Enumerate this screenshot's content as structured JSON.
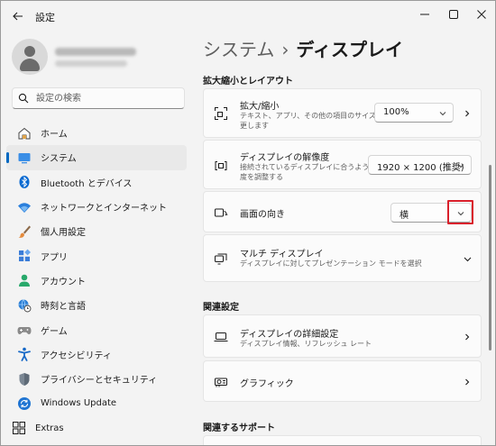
{
  "window": {
    "title": "設定"
  },
  "search": {
    "placeholder": "設定の検索"
  },
  "nav": [
    {
      "label": "ホーム",
      "icon": "home-icon"
    },
    {
      "label": "システム",
      "icon": "system-icon",
      "active": true
    },
    {
      "label": "Bluetooth とデバイス",
      "icon": "bluetooth-icon"
    },
    {
      "label": "ネットワークとインターネット",
      "icon": "wifi-icon"
    },
    {
      "label": "個人用設定",
      "icon": "brush-icon"
    },
    {
      "label": "アプリ",
      "icon": "apps-icon"
    },
    {
      "label": "アカウント",
      "icon": "account-icon"
    },
    {
      "label": "時刻と言語",
      "icon": "globe-clock-icon"
    },
    {
      "label": "ゲーム",
      "icon": "gamepad-icon"
    },
    {
      "label": "アクセシビリティ",
      "icon": "accessibility-icon"
    },
    {
      "label": "プライバシーとセキュリティ",
      "icon": "shield-icon"
    },
    {
      "label": "Windows Update",
      "icon": "update-icon"
    },
    {
      "label": "Extras",
      "icon": "grid-icon"
    }
  ],
  "breadcrumb": {
    "parent": "システム",
    "separator": "›",
    "current": "ディスプレイ"
  },
  "sections": {
    "scale_layout": "拡大縮小とレイアウト",
    "related_settings": "関連設定",
    "related_support": "関連するサポート"
  },
  "cards": {
    "scale": {
      "title": "拡大/縮小",
      "desc": "テキスト、アプリ、その他の項目のサイズを変更します",
      "value": "100%"
    },
    "resolution": {
      "title": "ディスプレイの解像度",
      "desc": "接続されているディスプレイに合うように解像度を調整する",
      "value": "1920 × 1200 (推奨)"
    },
    "orientation": {
      "title": "画面の向き",
      "value": "横"
    },
    "multi": {
      "title": "マルチ ディスプレイ",
      "desc": "ディスプレイに対してプレゼンテーション モードを選択"
    },
    "advanced": {
      "title": "ディスプレイの詳細設定",
      "desc": "ディスプレイ情報、リフレッシュ レート"
    },
    "graphics": {
      "title": "グラフィック"
    }
  },
  "colors": {
    "accent": "#0067c0",
    "highlight": "#d9202b"
  }
}
